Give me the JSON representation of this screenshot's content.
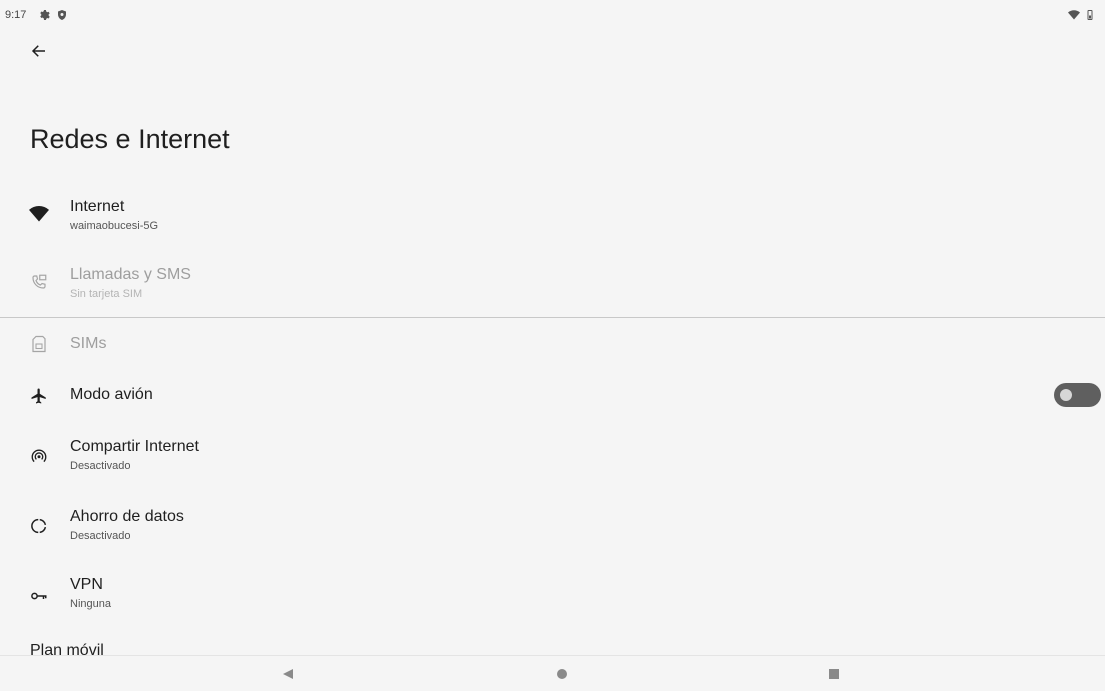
{
  "status_bar": {
    "time": "9:17",
    "icons": [
      "settings-icon",
      "shield-icon",
      "wifi-icon",
      "battery-icon"
    ]
  },
  "header": {
    "back_icon": "arrow-left-icon"
  },
  "page": {
    "title": "Redes e Internet"
  },
  "settings": [
    {
      "id": "internet",
      "title": "Internet",
      "subtitle": "waimaobucesi-5G",
      "icon": "wifi-icon",
      "enabled": true
    },
    {
      "id": "calls",
      "title": "Llamadas y SMS",
      "subtitle": "Sin tarjeta SIM",
      "icon": "phone-message-icon",
      "enabled": false
    },
    {
      "id": "sims",
      "title": "SIMs",
      "icon": "sim-card-icon",
      "enabled": false
    },
    {
      "id": "airplane",
      "title": "Modo avión",
      "icon": "airplane-icon",
      "enabled": true,
      "toggle_on": false
    },
    {
      "id": "hotspot",
      "title": "Compartir Internet",
      "subtitle": "Desactivado",
      "icon": "hotspot-icon",
      "enabled": true
    },
    {
      "id": "datasaver",
      "title": "Ahorro de datos",
      "subtitle": "Desactivado",
      "icon": "data-saver-icon",
      "enabled": true
    },
    {
      "id": "vpn",
      "title": "VPN",
      "subtitle": "Ninguna",
      "icon": "vpn-key-icon",
      "enabled": true
    }
  ],
  "partial_item": {
    "title": "Plan móvil"
  },
  "navigation_bar": {
    "buttons": [
      "back-triangle-icon",
      "home-circle-icon",
      "recents-square-icon"
    ]
  },
  "colors": {
    "background": "#f5f5f5",
    "text": "#1f1f1f",
    "disabled_text": "#9e9e9e",
    "toggle_track": "#5f5f5f"
  }
}
